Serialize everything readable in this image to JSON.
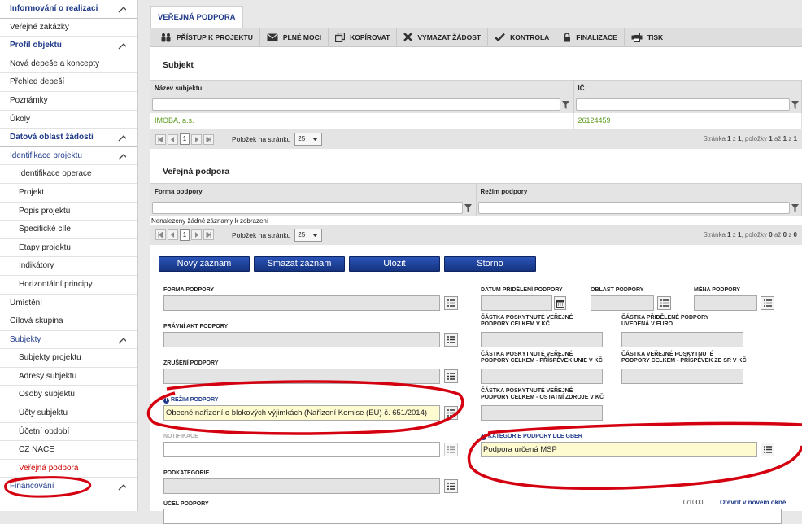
{
  "sidebar": {
    "items": [
      {
        "label": "Informování o realizaci",
        "type": "section",
        "chevron": true
      },
      {
        "label": "Veřejné zakázky",
        "type": "item"
      },
      {
        "label": "Profil objektu",
        "type": "section",
        "chevron": true
      },
      {
        "label": "Nová depeše a koncepty",
        "type": "item"
      },
      {
        "label": "Přehled depeší",
        "type": "item"
      },
      {
        "label": "Poznámky",
        "type": "item"
      },
      {
        "label": "Úkoly",
        "type": "item"
      },
      {
        "label": "Datová oblast žádosti",
        "type": "section",
        "chevron": true
      },
      {
        "label": "Identifikace projektu",
        "type": "group",
        "chevron": true
      },
      {
        "label": "Identifikace operace",
        "type": "sub"
      },
      {
        "label": "Projekt",
        "type": "sub"
      },
      {
        "label": "Popis projektu",
        "type": "sub"
      },
      {
        "label": "Specifické cíle",
        "type": "sub"
      },
      {
        "label": "Etapy projektu",
        "type": "sub"
      },
      {
        "label": "Indikátory",
        "type": "sub"
      },
      {
        "label": "Horizontální principy",
        "type": "sub"
      },
      {
        "label": "Umístění",
        "type": "item"
      },
      {
        "label": "Cílová skupina",
        "type": "item"
      },
      {
        "label": "Subjekty",
        "type": "group",
        "chevron": true
      },
      {
        "label": "Subjekty projektu",
        "type": "sub"
      },
      {
        "label": "Adresy subjektu",
        "type": "sub"
      },
      {
        "label": "Osoby subjektu",
        "type": "sub"
      },
      {
        "label": "Účty subjektu",
        "type": "sub"
      },
      {
        "label": "Účetní období",
        "type": "sub"
      },
      {
        "label": "CZ NACE",
        "type": "sub"
      },
      {
        "label": "Veřejná podpora",
        "type": "sub",
        "active": true
      },
      {
        "label": "Financování",
        "type": "group",
        "chevron": true
      }
    ]
  },
  "tab": {
    "label": "VEŘEJNÁ PODPORA"
  },
  "toolbar": {
    "access": "PŘÍSTUP K PROJEKTU",
    "power": "PLNÉ MOCI",
    "copy": "KOPÍROVAT",
    "delete": "VYMAZAT ŽÁDOST",
    "check": "KONTROLA",
    "finalize": "FINALIZACE",
    "print": "TISK"
  },
  "subject_panel": {
    "title": "Subjekt",
    "col_name": "Název subjektu",
    "col_ic": "IČ",
    "row_name": "IMOBA, a.s.",
    "row_ic": "26124459",
    "page": "1",
    "per_page_label": "Položek na stránku",
    "per_page": "25",
    "info_a": "Stránka ",
    "info_b": "1",
    "info_c": " z ",
    "info_d": "1",
    "info_e": ", položky ",
    "info_f": "1",
    "info_g": " až ",
    "info_h": "1",
    "info_i": " z ",
    "info_j": "1"
  },
  "support_panel": {
    "title": "Veřejná podpora",
    "col_form": "Forma podpory",
    "col_regime": "Režim podpory",
    "empty": "Nenalezeny žádné záznamy k zobrazení",
    "page": "1",
    "per_page_label": "Položek na stránku",
    "per_page": "25",
    "info_a": "Stránka ",
    "info_b": "1",
    "info_c": " z ",
    "info_d": "1",
    "info_e": ", položky ",
    "info_f": "0",
    "info_g": " až ",
    "info_h": "0",
    "info_i": " z ",
    "info_j": "0"
  },
  "actions": {
    "new": "Nový záznam",
    "delete": "Smazat záznam",
    "save": "Uložit",
    "cancel": "Storno"
  },
  "form": {
    "forma": "FORMA PODPORY",
    "pravni_akt": "PRÁVNÍ AKT PODPORY",
    "zruseni": "ZRUŠENÍ PODPORY",
    "rezim": "REŽIM PODPORY",
    "rezim_value": "Obecné nařízení o blokových výjimkách (Nařízení Komise (EU) č. 651/2014)",
    "notifikace": "NOTIFIKACE",
    "podkategorie": "PODKATEGORIE",
    "ucel": "ÚČEL PODPORY",
    "ucel_counter": "0/1000",
    "ucel_open": "Otevřít v novém okně",
    "datum": "DATUM PŘIDĚLENÍ PODPORY",
    "oblast": "OBLAST PODPORY",
    "mena": "MĚNA PODPORY",
    "castka_kc_1": "ČÁSTKA POSKYTNUTÉ VEŘEJNÉ",
    "castka_kc_2": "PODPORY CELKEM V KČ",
    "castka_eur_1": "ČÁSTKA PŘIDĚLENÉ PODPORY",
    "castka_eur_2": "UVEDENÁ V EURO",
    "castka_eu_1": "ČÁSTKA POSKYTNUTÉ VEŘEJNÉ",
    "castka_eu_2": "PODPORY CELKEM - PŘÍSPĚVEK UNIE V KČ",
    "castka_sr_1": "ČÁSTKA VEŘEJNÉ POSKYTNUTÉ",
    "castka_sr_2": "PODPORY CELKEM - PŘÍSPĚVEK ZE SR V KČ",
    "castka_oz_1": "ČÁSTKA POSKYTNUTÉ VEŘEJNÉ",
    "castka_oz_2": "PODPORY CELKEM - OSTATNÍ ZDROJE V KČ",
    "gber": "KATEGORIE PODPORY DLE GBER",
    "gber_value": "Podpora určená MSP"
  },
  "colors": {
    "accent": "#1f3a8a",
    "highlight": "#d40010",
    "green": "#5a9a1a"
  }
}
